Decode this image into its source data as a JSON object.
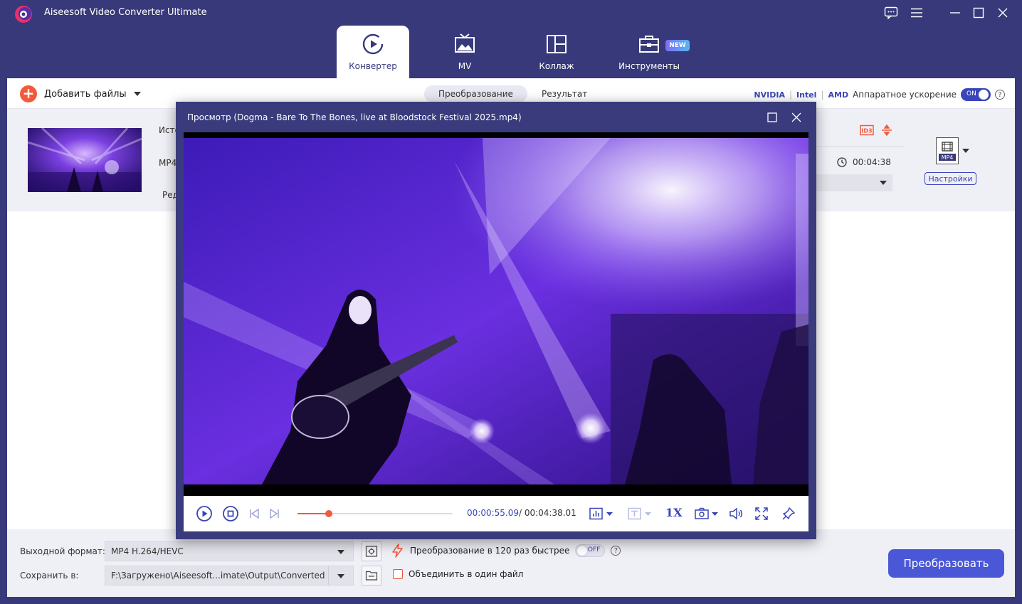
{
  "app": {
    "title": "Aiseesoft Video Converter Ultimate"
  },
  "nav": {
    "tabs": [
      {
        "label": "Конвертер",
        "icon": "converter-icon",
        "active": true
      },
      {
        "label": "MV",
        "icon": "mv-icon"
      },
      {
        "label": "Коллаж",
        "icon": "collage-icon"
      },
      {
        "label": "Инструменты",
        "icon": "toolbox-icon",
        "badge": "NEW"
      }
    ]
  },
  "toolbar": {
    "add_files": "Добавить файлы",
    "segments": [
      "Преобразование",
      "Результат"
    ],
    "hw": {
      "nvidia": "NVIDIA",
      "intel": "Intel",
      "amd": "AMD",
      "label": "Аппаратное ускорение",
      "toggle": "ON"
    }
  },
  "file": {
    "src_prefix": "Исто",
    "fmt_prefix": "MP4",
    "edit_prefix": "Ред",
    "duration": "00:04:38",
    "output_format": "MP4",
    "settings": "Настройки"
  },
  "preview": {
    "title": "Просмотр (Dogma - Bare To The Bones, live at Bloodstock Festival 2025.mp4)",
    "current_time": "00:00:55.09",
    "total_time": "/ 00:04:38.01",
    "speed": "1X",
    "progress": 0.2
  },
  "bottom": {
    "format_label": "Выходной формат:",
    "format_value": "MP4 H.264/HEVC",
    "save_label": "Сохранить в:",
    "save_value": "F:\\Загружено\\Aiseesoft...imate\\Output\\Converted",
    "fast_label": "Преобразование в 120 раз быстрее",
    "fast_toggle": "OFF",
    "merge_label": "Объединить в один файл",
    "convert": "Преобразовать"
  },
  "colors": {
    "frame": "#37397a",
    "accent": "#3945b8",
    "orange": "#f25a3c",
    "button": "#4a57d6"
  }
}
